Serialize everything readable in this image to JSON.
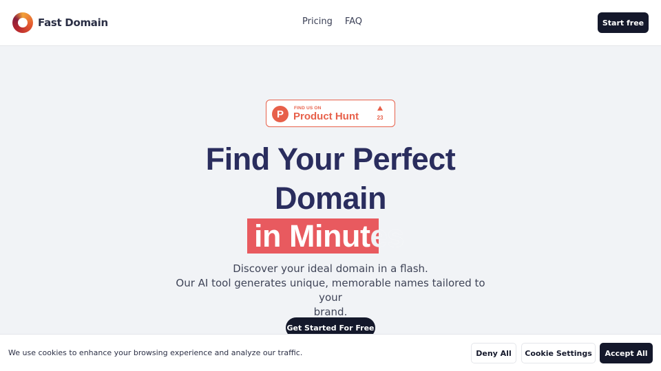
{
  "header": {
    "brand": "Fast Domain",
    "nav": [
      "Pricing",
      "FAQ"
    ],
    "cta_label": "Start free"
  },
  "product_hunt": {
    "small_label": "FIND US ON",
    "name": "Product Hunt",
    "logo_letter": "P",
    "upvotes": "23"
  },
  "hero": {
    "title_line1": "Find Your Perfect",
    "title_line2": "Domain",
    "highlight_main": "in Minut",
    "highlight_fade": "es",
    "description_lines": [
      "Discover your ideal domain in a flash.",
      "Our AI tool generates unique, memorable names tailored to your",
      "brand."
    ],
    "cta_label": "Get Started For Free"
  },
  "cookie": {
    "message": "We use cookies to enhance your browsing experience and analyze our traffic.",
    "deny_label": "Deny All",
    "settings_label": "Cookie Settings",
    "accept_label": "Accept All"
  },
  "colors": {
    "accent": "#e85a5f",
    "product_hunt": "#e7604a",
    "dark": "#14182b",
    "title": "#2a2d5e",
    "background": "#f1f3f6"
  }
}
